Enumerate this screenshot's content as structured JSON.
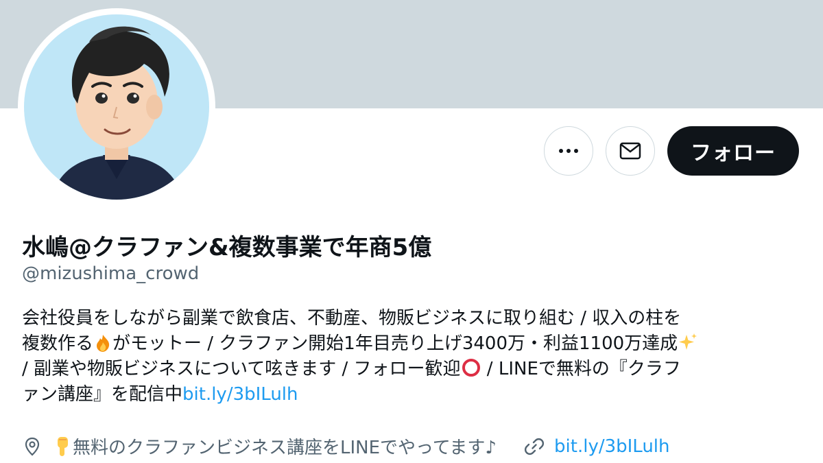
{
  "profile": {
    "display_name": "水嶋@クラファン&複数事業で年商5億",
    "handle": "@mizushima_crowd",
    "bio": {
      "line1": "会社役員をしながら副業で飲食店、不動産、物販ビジネスに取り組む / 収入の柱を",
      "line2_a": "複数作る",
      "line2_b": "がモットー / クラファン開始1年目売り上げ3400万・利益1100万達成",
      "line3_a": "/ 副業や物販ビジネスについて呟きます / フォロー歓迎",
      "line3_b": " / LINEで無料の『クラフ",
      "line4_a": "ァン講座』を配信中",
      "line4_link": "bit.ly/3bILulh"
    },
    "location": "無料のクラファンビジネス講座をLINEでやってます♪",
    "website": "bit.ly/3bILulh"
  },
  "actions": {
    "more_icon": "ellipsis-icon",
    "message_icon": "envelope-icon",
    "follow_label": "フォロー"
  },
  "colors": {
    "banner": "#cfd9de",
    "follow_bg": "#0f1419",
    "link": "#1d9bf0",
    "secondary_text": "#536471"
  }
}
